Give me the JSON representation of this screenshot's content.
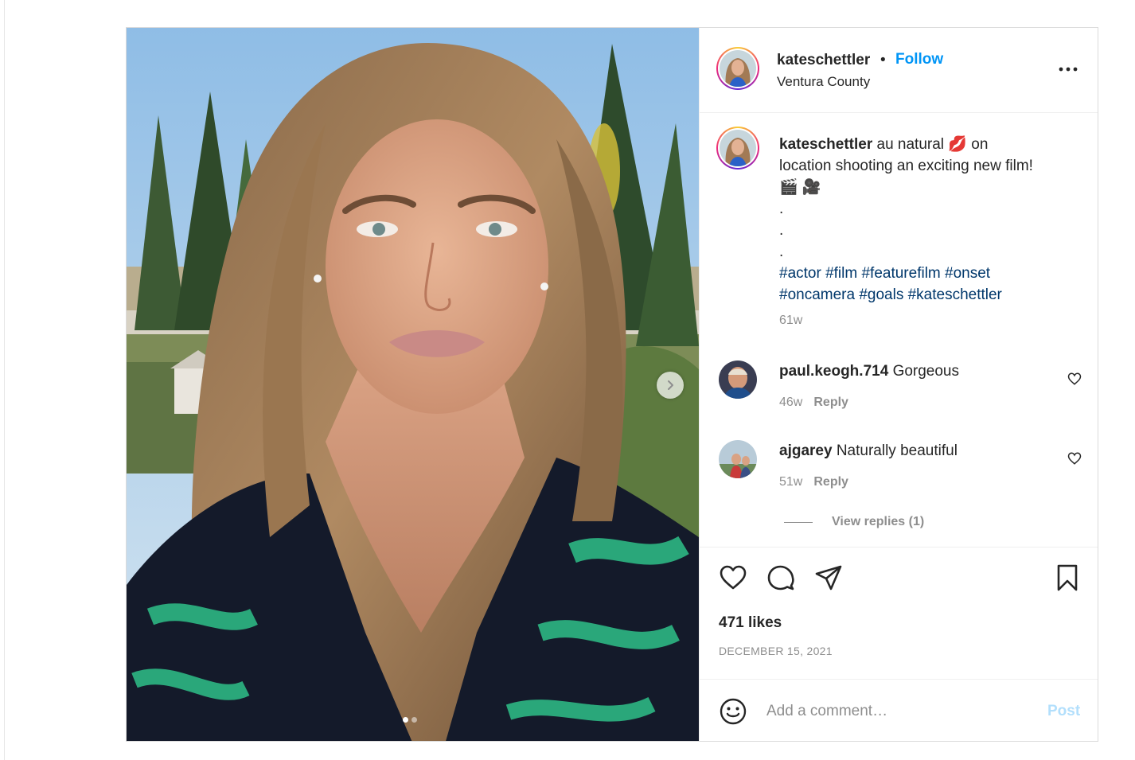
{
  "post": {
    "username": "kateschettler",
    "separator": "•",
    "follow_label": "Follow",
    "location": "Ventura County",
    "more_icon": "more-horizontal-icon"
  },
  "caption": {
    "username": "kateschettler",
    "text_before_emoji": " au natural ",
    "emoji_1": "💋",
    "text_after_emoji": " on location shooting an exciting new film! ",
    "emoji_2": "🎬 🎥",
    "dots": [
      ".",
      ".",
      "."
    ],
    "hashtags_line1": "#actor #film #featurefilm #onset",
    "hashtags_line2": "#oncamera #goals #kateschettler",
    "time": "61w"
  },
  "comments": [
    {
      "username": "paul.keogh.714",
      "text": "Gorgeous",
      "time": "46w",
      "reply_label": "Reply"
    },
    {
      "username": "ajgarey",
      "text": "Naturally beautiful",
      "time": "51w",
      "reply_label": "Reply"
    }
  ],
  "view_replies_label": "View replies (1)",
  "actions": {
    "like_icon": "heart-icon",
    "comment_icon": "comment-bubble-icon",
    "share_icon": "paper-plane-icon",
    "save_icon": "bookmark-icon"
  },
  "likes_text": "471 likes",
  "date_text": "DECEMBER 15, 2021",
  "add_comment": {
    "placeholder": "Add a comment…",
    "post_label": "Post",
    "emoji_icon": "smiley-icon"
  },
  "carousel": {
    "current": 1,
    "total": 2
  },
  "colors": {
    "follow_blue": "#0095f6",
    "hashtag_blue": "#00376b",
    "post_disabled": "#b2dffc",
    "secondary_text": "#8e8e8e"
  }
}
